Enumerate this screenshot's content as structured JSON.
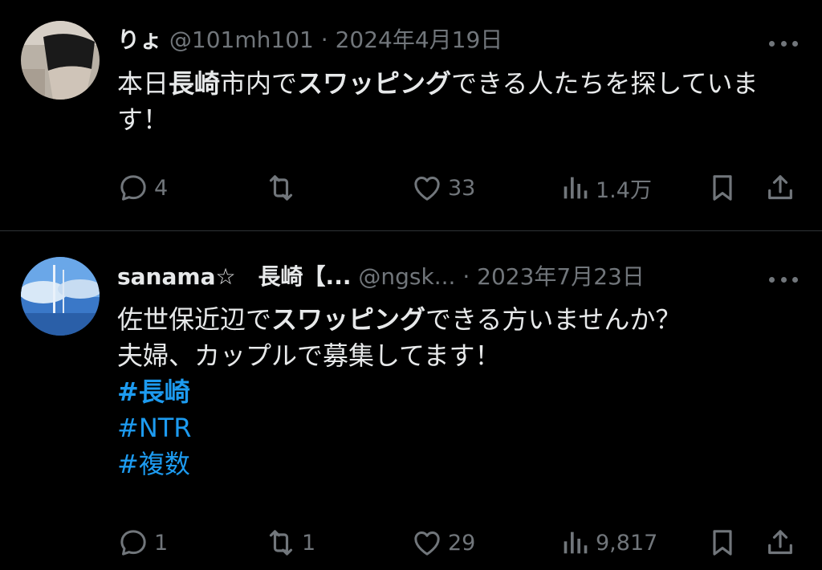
{
  "tweets": [
    {
      "user_name": "りょ",
      "handle": "@101mh101",
      "date": "2024年4月19日",
      "body_parts": [
        {
          "t": "本日",
          "b": false
        },
        {
          "t": "長崎",
          "b": true
        },
        {
          "t": "市内で",
          "b": false
        },
        {
          "t": "スワッピング",
          "b": true
        },
        {
          "t": "できる人たちを探しています！",
          "b": false
        }
      ],
      "hashtags": [],
      "replies": "4",
      "retweets": "",
      "likes": "33",
      "views": "1.4万"
    },
    {
      "user_name": "sanama☆　長崎【...",
      "handle": "@ngsk...",
      "date": "2023年7月23日",
      "body_line1_parts": [
        {
          "t": "佐世保近辺で",
          "b": false
        },
        {
          "t": "スワッピング",
          "b": true
        },
        {
          "t": "できる方いませんか？",
          "b": false
        }
      ],
      "body_line2": "夫婦、カップルで募集してます！",
      "hashtags": [
        "#長崎",
        "#NTR",
        "#複数"
      ],
      "replies": "1",
      "retweets": "1",
      "likes": "29",
      "views": "9,817"
    }
  ],
  "icons": [
    "reply-icon",
    "retweet-icon",
    "like-icon",
    "views-icon",
    "bookmark-icon",
    "share-icon",
    "more-icon"
  ],
  "colors": {
    "background": "#000000",
    "text": "#e7e9ea",
    "muted": "#71767b",
    "link": "#1d9bf0",
    "divider": "#2f3336"
  }
}
